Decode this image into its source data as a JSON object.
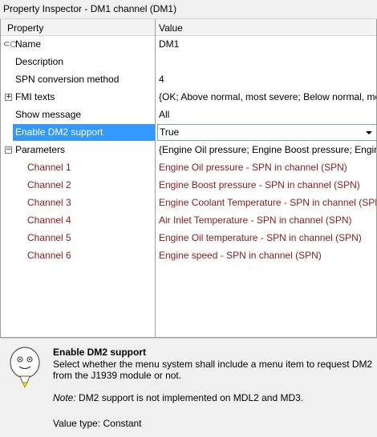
{
  "window": {
    "title": "Property Inspector - DM1 channel (DM1)"
  },
  "columns": {
    "property": "Property",
    "value": "Value"
  },
  "rows": [
    {
      "name": "Name",
      "value": "DM1"
    },
    {
      "name": "Description",
      "value": ""
    },
    {
      "name": "SPN conversion method",
      "value": "4"
    },
    {
      "name": "FMI texts",
      "value": "{OK; Above normal, most severe; Below normal, mo"
    },
    {
      "name": "Show message",
      "value": "All"
    },
    {
      "name": "Enable DM2 support",
      "value": "True"
    },
    {
      "name": "Parameters",
      "value": "{Engine Oil pressure; Engine Boost pressure; Engine"
    }
  ],
  "channels": [
    {
      "name": "Channel 1",
      "value": "Engine Oil pressure - SPN in channel (SPN)"
    },
    {
      "name": "Channel 2",
      "value": "Engine Boost pressure - SPN in channel (SPN)"
    },
    {
      "name": "Channel 3",
      "value": "Engine Coolant Temperature - SPN in channel (SPN"
    },
    {
      "name": "Channel 4",
      "value": "Air Inlet Temperature - SPN in channel (SPN)"
    },
    {
      "name": "Channel 5",
      "value": "Engine Oil temperature - SPN in channel (SPN)"
    },
    {
      "name": "Channel 6",
      "value": "Engine speed - SPN in channel (SPN)"
    }
  ],
  "help": {
    "title": "Enable DM2 support",
    "description": "Select whether the menu system shall include a menu item to request DM2 from the J1939 module or not.",
    "note_label": "Note:",
    "note_text": " DM2 support is not implemented on MDL2 and MD3.",
    "value_type": "Value type: Constant"
  },
  "icons": {
    "name_row": "link-icon",
    "fmi_expander": "expand-plus-icon",
    "parameters_expander": "collapse-minus-icon",
    "dropdown": "chevron-down-icon",
    "help": "lightbulb-icon"
  },
  "colors": {
    "selection": "#3399ff",
    "child_text": "#8b1a1a"
  }
}
